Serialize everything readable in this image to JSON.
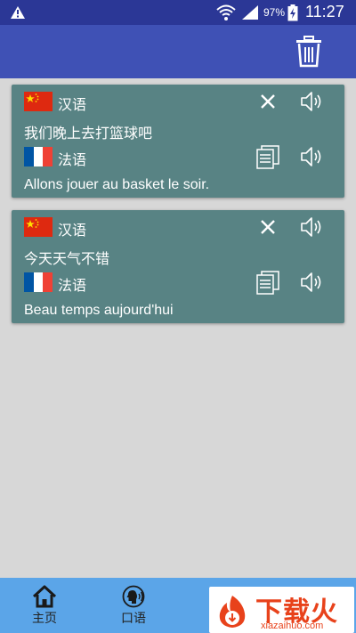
{
  "status_bar": {
    "battery_percent": "97%",
    "time": "11:27",
    "icons": [
      "warning-icon",
      "wifi-icon",
      "signal-icon",
      "battery-charging-icon"
    ]
  },
  "app_bar": {
    "actions": [
      "trash-icon"
    ]
  },
  "translations": [
    {
      "source_lang": "汉语",
      "source_flag": "china-flag-icon",
      "source_text": "我们晚上去打篮球吧",
      "target_lang": "法语",
      "target_flag": "france-flag-icon",
      "target_text": "Allons jouer au basket le soir."
    },
    {
      "source_lang": "汉语",
      "source_flag": "china-flag-icon",
      "source_text": "今天天气不错",
      "target_lang": "法语",
      "target_flag": "france-flag-icon",
      "target_text": "Beau temps aujourd'hui"
    }
  ],
  "bottom_nav": {
    "home_label": "主页",
    "spoken_label": "口语"
  },
  "watermark": {
    "title": "下载火",
    "url": "xiazaihuo.com"
  },
  "colors": {
    "status_bar": "#2b3796",
    "app_bar": "#3f51b5",
    "card": "#588384",
    "background": "#d7d7d7",
    "bottom_nav": "#5ba5e8",
    "watermark": "#e8421b"
  }
}
